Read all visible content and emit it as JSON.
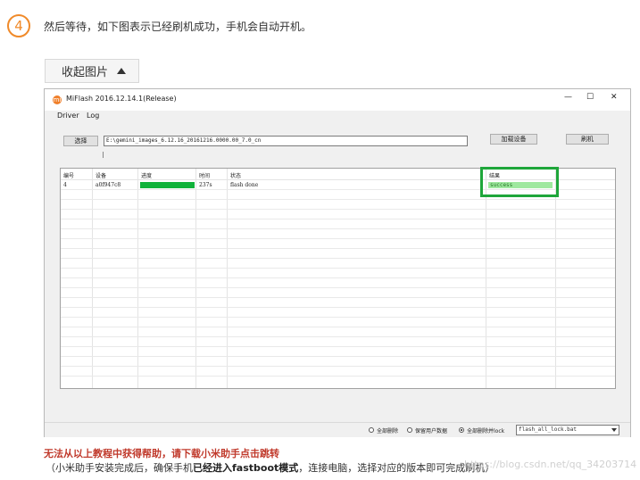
{
  "step": {
    "number": "4",
    "text": "然后等待，如下图表示已经刷机成功，手机会自动开机。"
  },
  "collapse_button": {
    "label": "收起图片"
  },
  "window": {
    "title": "MiFlash 2016.12.14.1(Release)",
    "icon_letter": "mi",
    "controls": {
      "minimize": "—",
      "maximize": "☐",
      "close": "✕"
    },
    "menu": [
      "Driver",
      "Log"
    ],
    "buttons": {
      "select": "选择",
      "load_device": "加载设备",
      "flash": "刷机"
    },
    "path_value": "E:\\gemini_images_6.12.16_20161216.0000.00_7.0_cn",
    "table": {
      "headers": [
        "编号",
        "设备",
        "进度",
        "时间",
        "状态",
        "结果"
      ],
      "rows": [
        {
          "id": "4",
          "device": "a0f947c8",
          "progress": 1.0,
          "time": "237s",
          "status": "flash done",
          "result": "success"
        }
      ]
    },
    "status_bar": {
      "options": [
        "全部删除",
        "保留用户数据",
        "全部删除并lock"
      ],
      "selected": 2,
      "script": "flash_all_lock.bat"
    }
  },
  "help": {
    "warning": "无法从以上教程中获得帮助，请下载小米助手点击跳转",
    "note_prefix": "（小米助手安装完成后，确保手机",
    "note_bold1": "已经进入",
    "note_bold2": "fastboot模式",
    "note_suffix": "，连接电脑，选择对应的版本即可完成刷机）"
  },
  "watermark": "https://blog.csdn.net/qq_34203714",
  "colors": {
    "accent": "#f08a2a",
    "progress": "#10b23a",
    "highlight": "#1ea63a",
    "warning": "#c0392b"
  }
}
